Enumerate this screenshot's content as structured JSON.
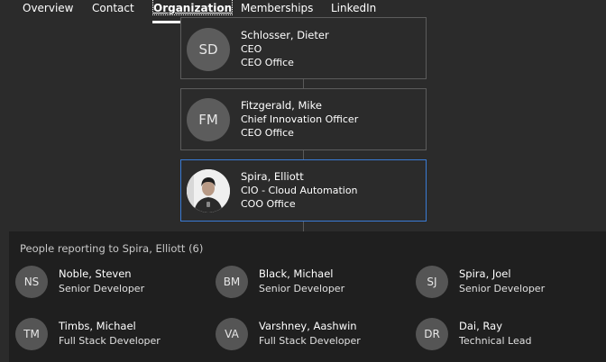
{
  "tabs": {
    "overview": "Overview",
    "contact": "Contact",
    "organization": "Organization",
    "memberships": "Memberships",
    "linkedin": "LinkedIn"
  },
  "chain": [
    {
      "initials": "SD",
      "name": "Schlosser, Dieter",
      "title": "CEO",
      "department": "CEO Office"
    },
    {
      "initials": "FM",
      "name": "Fitzgerald, Mike",
      "title": "Chief Innovation Officer",
      "department": "CEO Office"
    },
    {
      "initials": "",
      "name": "Spira, Elliott",
      "title": "CIO - Cloud Automation",
      "department": "COO Office"
    }
  ],
  "reports": {
    "title": "People reporting to Spira, Elliott (6)",
    "people": [
      {
        "initials": "NS",
        "name": "Noble, Steven",
        "title": "Senior Developer"
      },
      {
        "initials": "BM",
        "name": "Black, Michael",
        "title": "Senior Developer"
      },
      {
        "initials": "SJ",
        "name": "Spira, Joel",
        "title": "Senior Developer"
      },
      {
        "initials": "TM",
        "name": "Timbs, Michael",
        "title": "Full Stack Developer"
      },
      {
        "initials": "VA",
        "name": "Varshney, Aashwin",
        "title": "Full Stack Developer"
      },
      {
        "initials": "DR",
        "name": "Dai, Ray",
        "title": "Technical Lead"
      }
    ]
  },
  "colors": {
    "background": "#2b2b2b",
    "panel": "#1f1f1f",
    "selected_border": "#3a7bd5",
    "avatar": "#5c5c5c"
  }
}
